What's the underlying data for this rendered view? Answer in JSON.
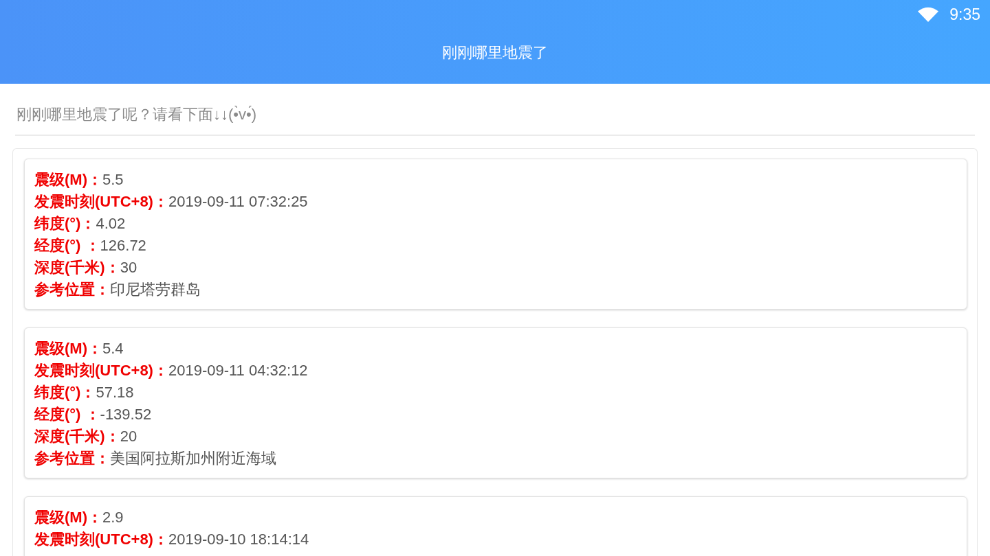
{
  "status_bar": {
    "time": "9:35"
  },
  "app_bar": {
    "title": "刚刚哪里地震了"
  },
  "intro": "刚刚哪里地震了呢？请看下面↓↓(•̀v•́)",
  "earthquakes": [
    {
      "fields": [
        {
          "label": "震级(M)：",
          "value": "5.5"
        },
        {
          "label": "发震时刻(UTC+8)：",
          "value": "2019-09-11 07:32:25"
        },
        {
          "label": "纬度(°)：",
          "value": "4.02"
        },
        {
          "label": "经度(°) ：",
          "value": "126.72"
        },
        {
          "label": "深度(千米)：",
          "value": "30"
        },
        {
          "label": "参考位置：",
          "value": "印尼塔劳群岛"
        }
      ]
    },
    {
      "fields": [
        {
          "label": "震级(M)：",
          "value": "5.4"
        },
        {
          "label": "发震时刻(UTC+8)：",
          "value": "2019-09-11 04:32:12"
        },
        {
          "label": "纬度(°)：",
          "value": "57.18"
        },
        {
          "label": "经度(°) ：",
          "value": "-139.52"
        },
        {
          "label": "深度(千米)：",
          "value": "20"
        },
        {
          "label": "参考位置：",
          "value": "美国阿拉斯加州附近海域"
        }
      ]
    },
    {
      "fields": [
        {
          "label": "震级(M)：",
          "value": "2.9"
        },
        {
          "label": "发震时刻(UTC+8)：",
          "value": "2019-09-10 18:14:14"
        }
      ]
    }
  ]
}
